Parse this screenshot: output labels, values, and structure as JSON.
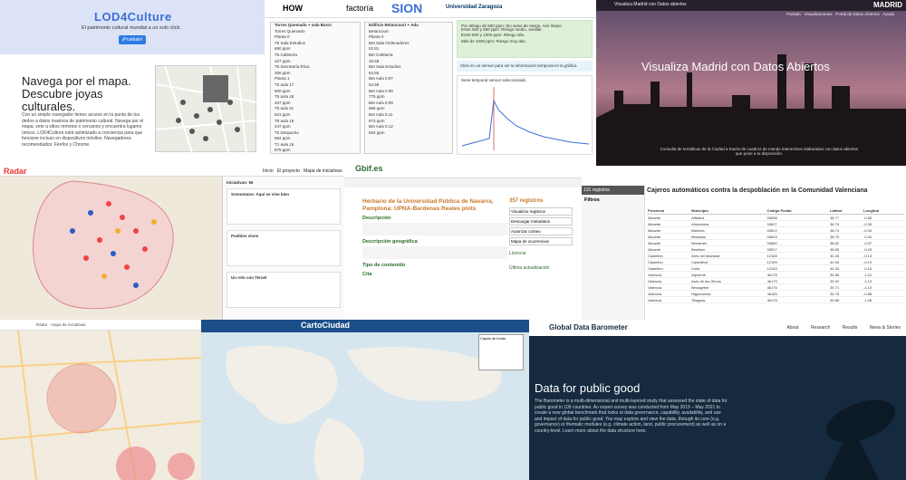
{
  "tile1": {
    "brand": "LOD4Culture",
    "tagline": "El patrimonio cultural mundial a un solo click.",
    "button": "¡Pruébalo!",
    "heading1": "Navega por el mapa.",
    "heading2": "Descubre joyas culturales.",
    "paragraph": "Con un simple navegador tienes acceso en la punta de tus dedos a datos masivos de patrimonio cultural. Navega por el mapa, vete a sitios remotos o cercanos y encuentra lugares únicos. LOD4Culture está optimizado a conciencia para que funcione incluso en dispositivos móviles. Navegadores recomendados: Firefox y Chrome."
  },
  "tile2": {
    "logos": [
      "HOW",
      "factoría",
      "SION",
      "Universidad Zaragoza"
    ],
    "tree_title": "Torres Quemado + sala Barro",
    "tree_items": [
      "Torres Quemado",
      "Planta 0",
      "T5 Sala Estudios",
      "690 ppm",
      "T6 Cafetería",
      "427 ppm",
      "T5 Secretaría Ética",
      "356 ppm",
      "Planta 1",
      "T5 aula 17",
      "500 ppm",
      "T5 aula 18",
      "467 ppm",
      "T5 aula 21",
      "621 ppm",
      "T5 aula 19",
      "447 ppm",
      "T5 Despacho",
      "594 ppm",
      "T1 aula 18",
      "875 ppm"
    ],
    "tree2_title": "Edificio Betancourt + Ada",
    "tree2_items": [
      "Betancourt",
      "Planta 0",
      "Bet Sala Ordenadores",
      "52.81",
      "Bet Cafetería",
      "16.58",
      "Bet Sala Estudios",
      "54.55",
      "Bet Aula 0.07",
      "54.56",
      "Bet Aula 0.08",
      "775 ppm",
      "Bet Aula 0.09",
      "656 ppm",
      "Bet Aula 0.11",
      "873 ppm",
      "Bet Aula 0.12",
      "554 ppm"
    ],
    "alert_lines": [
      "Por debajo de 500 ppm: Sin aviso de riesgo. Aire limpio.",
      "Entre 500 y 800 ppm: Riesgo medio, ventilar.",
      "Entre 800 y 1000 ppm: Riesgo alto.",
      "Más de 1000 ppm: Riesgo muy alto."
    ],
    "alert2": "Click en un sensor para ver la información temporal en la gráfica",
    "chart_title": "Serie temporal sensor seleccionado"
  },
  "tile3": {
    "nav_title": "Visualiza Madrid con Datos abiertos",
    "nav_items": [
      "Portada",
      "Visualizaciones",
      "Portal de Datos Abiertos",
      "Ayuda"
    ],
    "madrid": "MADRID",
    "title": "Visualiza Madrid con Datos Abiertos",
    "desc": "Consulta de temáticas de la Ciudad a través de cuadros de mando interactivos elaborados con datos abiertos que pone a tu disposición."
  },
  "tile4": {
    "logo": "Radar",
    "nav": [
      "Inicio",
      "El proyecto",
      "Mapa de iniciativas"
    ],
    "panel_title": "Iniciativas: 56",
    "items": [
      "Somontano: Aquí se vive bien",
      "Pueblos vivos",
      "Un reto con Teruel"
    ]
  },
  "tile5": {
    "brand": "Gbif.es",
    "title": "Herbario de la Universidad Pública de Navarra, Pamplona: UPNA-Bardenas Reales plots",
    "section1": "Descripción",
    "section2": "Descripción geográfica",
    "section3": "Tipo de contenido",
    "section4": "Cita",
    "side_count": "357 registros",
    "side_links": [
      "Visualizar registros",
      "Descargar metadatos",
      "Autorizar conteo",
      "Mapa de ocurrencias"
    ],
    "side_license": "Licencia",
    "side_date": "Última actualización"
  },
  "tile6": {
    "count": "131 registros",
    "filters": "Filtros",
    "title": "Cajeros automáticos contra la despoblación en la Comunidad Valenciana",
    "columns": [
      "Provincia",
      "Municipio",
      "Código Postal",
      "Latitud",
      "Longitud"
    ],
    "rows": [
      [
        "Alicante",
        "Alfafara",
        "03838",
        "38.77",
        "-0.56"
      ],
      [
        "Alicante",
        "Almudaina",
        "03827",
        "38.76",
        "-0.35"
      ],
      [
        "Alicante",
        "Balones",
        "03812",
        "38.74",
        "-0.34"
      ],
      [
        "Alicante",
        "Benasau",
        "03815",
        "38.70",
        "-0.34"
      ],
      [
        "Alicante",
        "Beniarrés",
        "03850",
        "38.82",
        "-0.37"
      ],
      [
        "Alicante",
        "Benifato",
        "03517",
        "38.65",
        "-0.23"
      ],
      [
        "Castellón",
        "Ares del Maestrat",
        "12165",
        "40.45",
        "-0.13"
      ],
      [
        "Castellón",
        "Castellfort",
        "12159",
        "40.50",
        "-0.19"
      ],
      [
        "Castellón",
        "Culla",
        "12163",
        "40.33",
        "-0.16"
      ],
      [
        "Valencia",
        "Alpuente",
        "46178",
        "39.88",
        "-1.01"
      ],
      [
        "Valencia",
        "Aras de los Olmos",
        "46179",
        "39.92",
        "-1.13"
      ],
      [
        "Valencia",
        "Benagéber",
        "46176",
        "39.71",
        "-1.10"
      ],
      [
        "Valencia",
        "Higueruelas",
        "46169",
        "39.78",
        "-0.88"
      ],
      [
        "Valencia",
        "Titaguas",
        "46178",
        "39.86",
        "-1.08"
      ]
    ]
  },
  "tile7": {
    "bar": "Radar · mapa de iniciativas"
  },
  "tile8": {
    "title": "CartoCiudad",
    "layers": "Capas de fondo"
  },
  "tile9": {
    "brand": "Global Data Barometer",
    "nav": [
      "About",
      "Research",
      "Results",
      "News & Stories"
    ],
    "heading": "Data for public good",
    "paragraph": "The Barometer is a multi-dimensional and multi-layered study that assessed the state of data for public good in 109 countries. An expert survey was conducted from May 2019 – May 2021 to create a new global benchmark that looks at data governance, capability, availability, and use and impact of data for public good. You may explore and view the data, through its core (e.g. governance) or thematic modules (e.g. climate action, land, public procurement) as well as on a country-level. Learn more about the data structure here."
  }
}
